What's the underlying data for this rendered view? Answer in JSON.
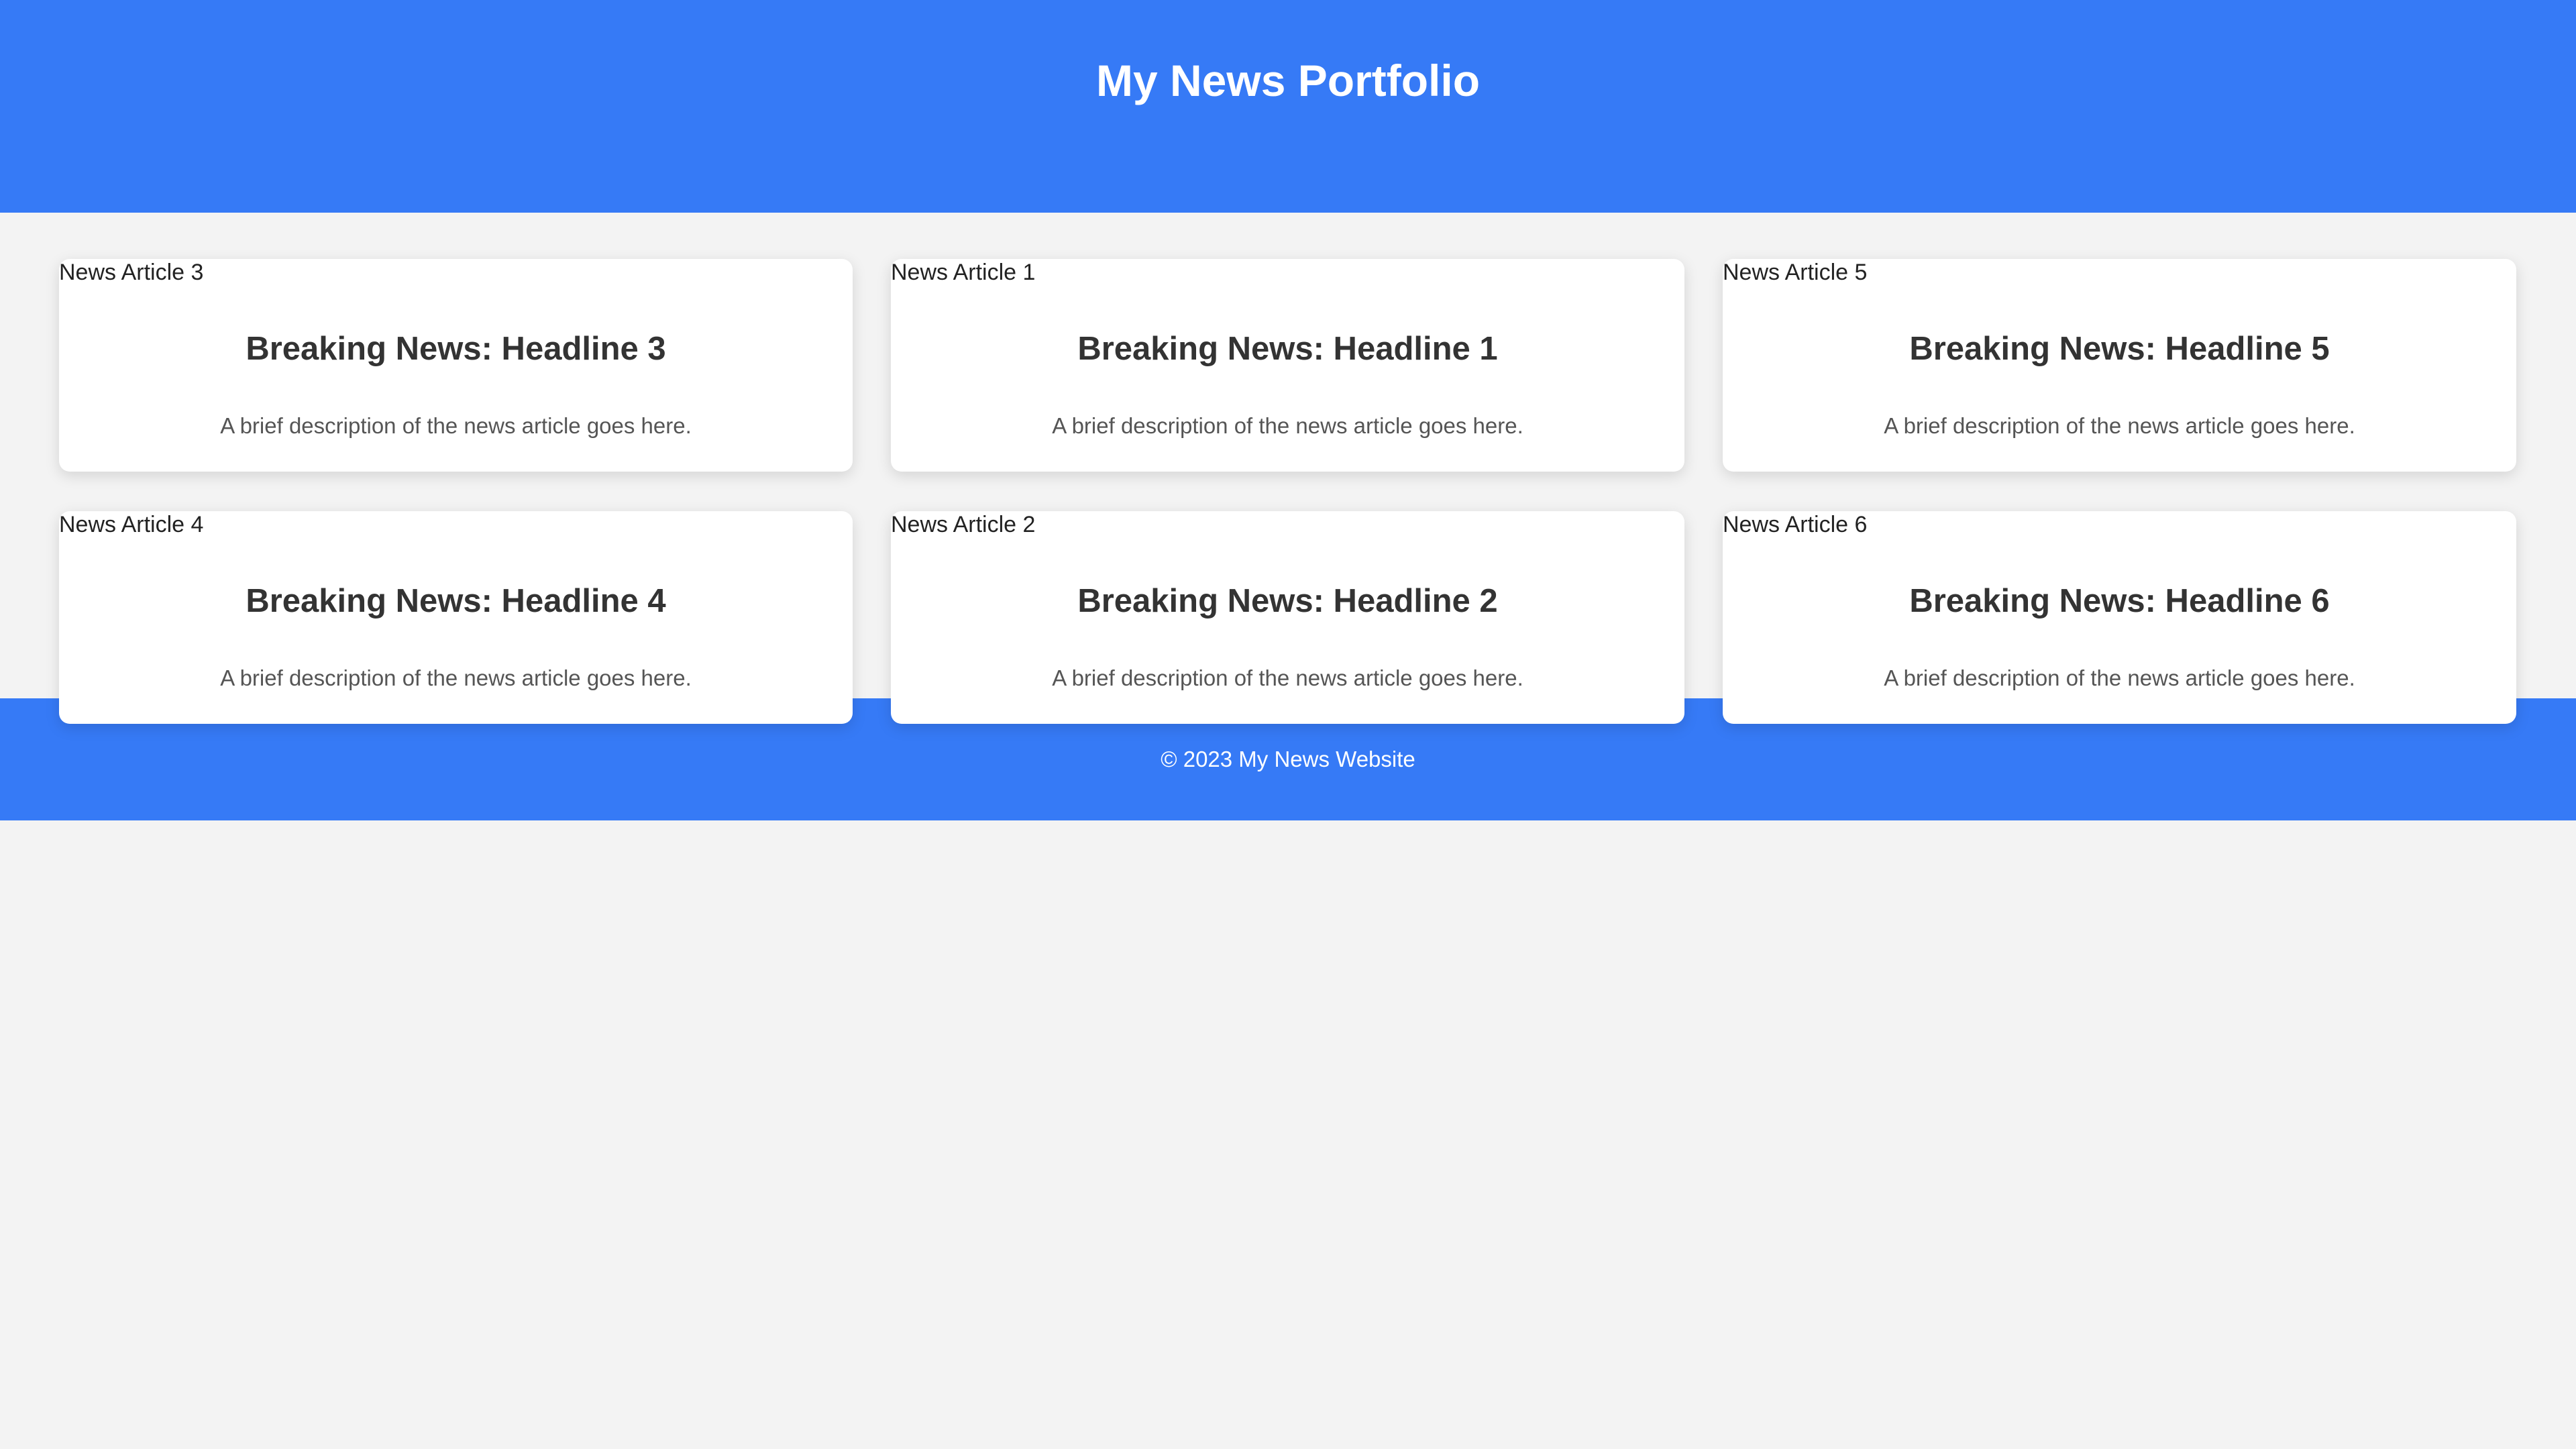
{
  "header": {
    "title": "My News Portfolio"
  },
  "articles": [
    {
      "image_alt": "News Article 3",
      "headline": "Breaking News: Headline 3",
      "description": "A brief description of the news article goes here."
    },
    {
      "image_alt": "News Article 1",
      "headline": "Breaking News: Headline 1",
      "description": "A brief description of the news article goes here."
    },
    {
      "image_alt": "News Article 5",
      "headline": "Breaking News: Headline 5",
      "description": "A brief description of the news article goes here."
    },
    {
      "image_alt": "News Article 4",
      "headline": "Breaking News: Headline 4",
      "description": "A brief description of the news article goes here."
    },
    {
      "image_alt": "News Article 2",
      "headline": "Breaking News: Headline 2",
      "description": "A brief description of the news article goes here."
    },
    {
      "image_alt": "News Article 6",
      "headline": "Breaking News: Headline 6",
      "description": "A brief description of the news article goes here."
    }
  ],
  "footer": {
    "copyright": "© 2023 My News Website"
  },
  "colors": {
    "header_bg": "#367af6",
    "page_bg": "#f3f3f3",
    "card_bg": "#ffffff",
    "headline": "#333333",
    "description": "#555555"
  }
}
